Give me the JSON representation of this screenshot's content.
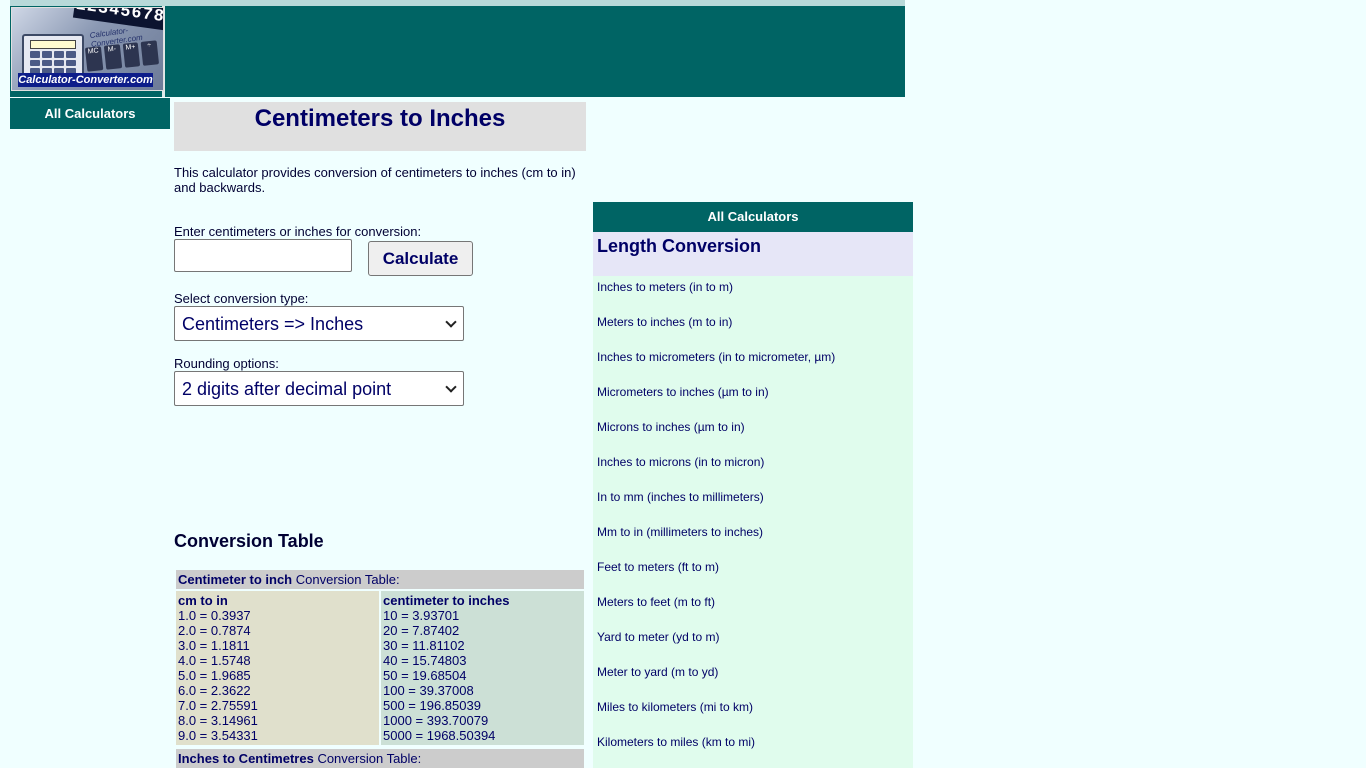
{
  "logo": {
    "text": "Calculator-Converter.com",
    "digits": "12345678",
    "keypad": [
      "MC",
      "M-",
      "M+",
      "÷"
    ]
  },
  "sidebar_left": {
    "all_calculators_label": "All Calculators"
  },
  "main": {
    "title": "Centimeters to Inches",
    "intro": "This calculator provides conversion of centimeters to inches (cm to in) and backwards.",
    "input_label": "Enter centimeters or inches for conversion:",
    "input_value": "",
    "calculate_label": "Calculate",
    "conversion_type_label": "Select conversion type:",
    "conversion_type_selected": "Centimeters => Inches",
    "rounding_label": "Rounding options:",
    "rounding_selected": "2 digits after decimal point"
  },
  "conversion_table": {
    "heading": "Conversion Table",
    "table1_title_bold": "Centimeter to inch",
    "table1_title_rest": " Conversion Table:",
    "col1_header": "cm to in",
    "col1_rows": [
      "1.0 = 0.3937",
      "2.0 = 0.7874",
      "3.0 = 1.1811",
      "4.0 = 1.5748",
      "5.0 = 1.9685",
      "6.0 = 2.3622",
      "7.0 = 2.75591",
      "8.0 = 3.14961",
      "9.0 = 3.54331"
    ],
    "col2_header": "centimeter to inches",
    "col2_rows": [
      "10 = 3.93701",
      "20 = 7.87402",
      "30 = 11.81102",
      "40 = 15.74803",
      "50 = 19.68504",
      "100 = 39.37008",
      "500 = 196.85039",
      "1000 = 393.70079",
      "5000 = 1968.50394"
    ],
    "table2_title_bold": "Inches to Centimetres",
    "table2_title_rest": " Conversion Table:"
  },
  "sidebar_right": {
    "all_calculators_label": "All Calculators",
    "section_heading": "Length Conversion",
    "links": [
      "Inches to meters (in to m)",
      "Meters to inches (m to in)",
      "Inches to micrometers (in to micrometer, µm)",
      "Micrometers to inches (µm to in)",
      "Microns to inches (µm to in)",
      "Inches to microns (in to micron)",
      "In to mm (inches to millimeters)",
      "Mm to in (millimeters to inches)",
      "Feet to meters (ft to m)",
      "Meters to feet (m to ft)",
      "Yard to meter (yd to m)",
      "Meter to yard (m to yd)",
      "Miles to kilometers (mi to km)",
      "Kilometers to miles (km to mi)"
    ]
  }
}
